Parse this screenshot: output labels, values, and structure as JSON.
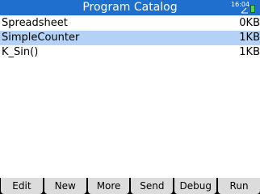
{
  "title_bar": {
    "title": "Program Catalog",
    "clock": "16:04",
    "colors": {
      "background": "#1f6fcf",
      "text": "#ffffff"
    },
    "icons": [
      "angle-mode-icon",
      "battery-icon"
    ]
  },
  "programs": [
    {
      "name": "Spreadsheet",
      "size": "0KB",
      "selected": false
    },
    {
      "name": "SimpleCounter",
      "size": "1KB",
      "selected": true
    },
    {
      "name": "K_Sin()",
      "size": "1KB",
      "selected": false
    }
  ],
  "selection_color": "#b4d2f5",
  "softkeys": [
    {
      "label": "Edit"
    },
    {
      "label": "New"
    },
    {
      "label": "More"
    },
    {
      "label": "Send"
    },
    {
      "label": "Debug"
    },
    {
      "label": "Run"
    }
  ]
}
